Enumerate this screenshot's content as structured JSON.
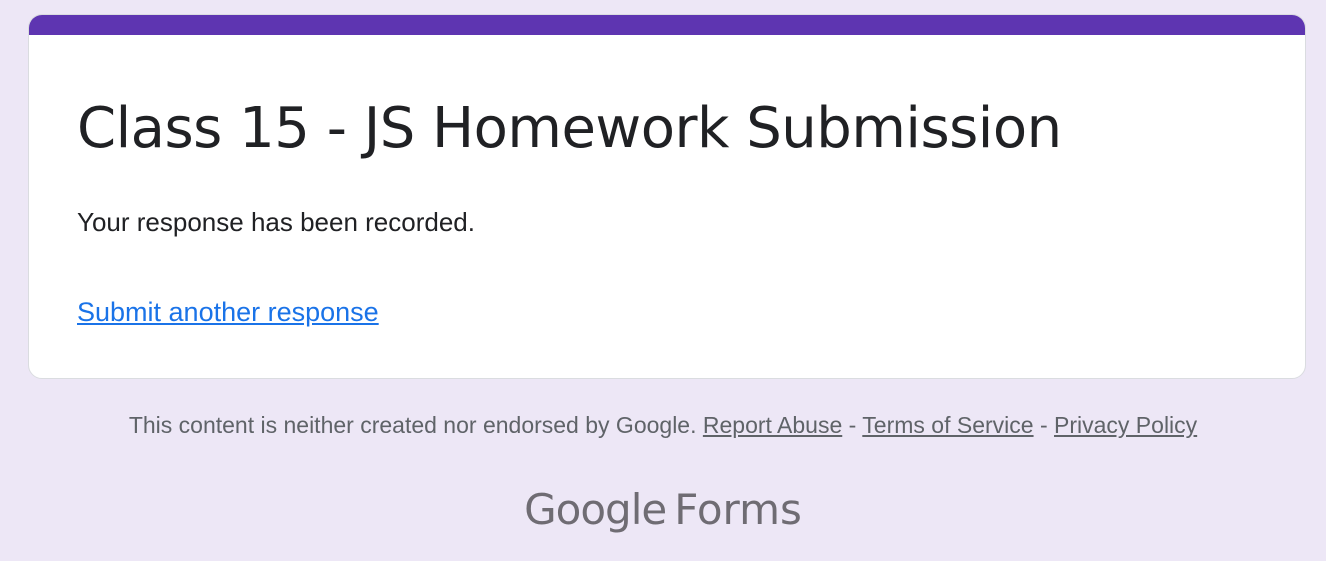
{
  "form": {
    "title": "Class 15 - JS Homework Submission",
    "confirmation": "Your response has been recorded.",
    "submit_another_label": "Submit another response",
    "accent_color": "#5e35b1",
    "link_color": "#1a73e8"
  },
  "page": {
    "background_color": "#ede7f6"
  },
  "footer": {
    "disclaimer": "This content is neither created nor endorsed by Google.",
    "report_abuse": "Report Abuse",
    "terms": "Terms of Service",
    "privacy": "Privacy Policy",
    "separator": "-"
  },
  "brand": {
    "google": "Google",
    "product": "Forms"
  }
}
